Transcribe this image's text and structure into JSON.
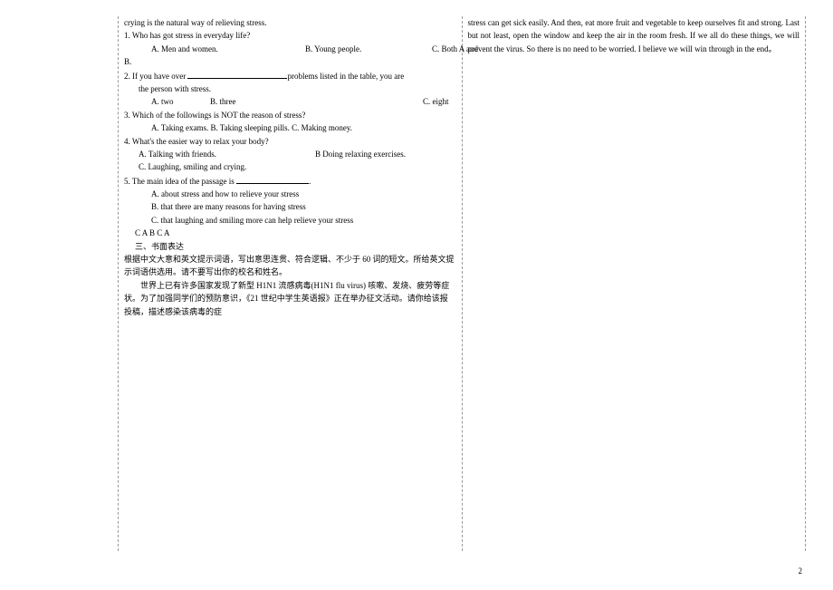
{
  "left": {
    "l0": "crying is the natural way of relieving stress.",
    "q1": "1. Who has got stress in everyday life?",
    "q1a": "A. Men and women.",
    "q1b": "B. Young people.",
    "q1c": "C. Both A and",
    "q1d": "B.",
    "q2a": "2. If you have over  ",
    "q2b": "problems listed in the table, you are",
    "q2c": "the person with stress.",
    "q2opt_a": "A. two",
    "q2opt_b": "B. three",
    "q2opt_c": "C. eight",
    "q3": "3. Which of the followings is NOT the reason of stress?",
    "q3opts": "A. Taking exams.   B. Taking sleeping pills.   C. Making money.",
    "q4": "4. What's the easier way to relax your body?",
    "q4a": "A. Talking with friends.",
    "q4b": "B Doing relaxing exercises.",
    "q4c": "C. Laughing, smiling and crying.",
    "q5a": "5. The main idea of the passage is ",
    "q5b": ".",
    "q5oa": "A. about stress and how to relieve your stress",
    "q5ob": "B. that there are many reasons for having stress",
    "q5oc": "C. that laughing and smiling more can help relieve your stress",
    "ans": "C A B C A",
    "sec": "三、书面表达",
    "p1": "根据中文大意和英文提示词语，写出意思连贯、符合逻辑、不少于 60 词的短文。所给英文提示词语供选用。请不要写出你的校名和姓名。",
    "p2": "世界上已有许多国家发现了新型 H1N1 流感病毒(H1N1 flu virus) 咳嗽、发烧、疲劳等症状。为了加强同学们的预防意识，《21 世纪中学生英语报》正在举办征文活动。请你给该报投稿，描述感染该病毒的症"
  },
  "right": {
    "r1": "stress can get sick easily. And then, eat more fruit and vegetable to keep ourselves fit and strong. Last but not least, open the window and keep the air in the room fresh. If we all do these things, we will prevent the virus. So there is no need to be worried. I believe we will win through in the end。"
  },
  "pagenum": "2"
}
